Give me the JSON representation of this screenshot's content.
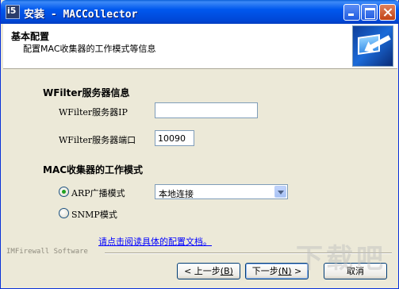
{
  "window": {
    "title": "安装 - MACCollector",
    "icon_text": "i5"
  },
  "header": {
    "title": "基本配置",
    "subtitle": "配置MAC收集器的工作模式等信息"
  },
  "server_section": {
    "title": "WFilter服务器信息",
    "ip_label": "WFilter服务器IP",
    "ip_value": "",
    "port_label": "WFilter服务器端口",
    "port_value": "10090"
  },
  "mode_section": {
    "title": "MAC收集器的工作模式",
    "arp_label": "ARP广播模式",
    "arp_checked": true,
    "interface_selected": "本地连接",
    "snmp_label": "SNMP模式",
    "snmp_checked": false
  },
  "doc_link": "请点击阅读具体的配置文档。",
  "brand": "IMFirewall Software",
  "buttons": {
    "back_label": "< 上一步",
    "back_key": "(B)",
    "next_label": "下一步",
    "next_key": "(N)",
    "next_suffix": " >",
    "cancel_label": "取消"
  },
  "icons": [
    "app-icon",
    "minimize-icon",
    "maximize-icon",
    "close-icon",
    "setup-logo-icon",
    "dropdown-arrow-icon"
  ],
  "colors": {
    "titlebar": "#0058ee",
    "face": "#ece9d8",
    "link": "#0000ff"
  }
}
